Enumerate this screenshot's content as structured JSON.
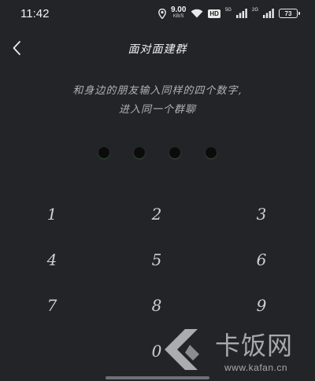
{
  "status_bar": {
    "time": "11:42",
    "net_speed_value": "9.00",
    "net_speed_unit": "KB/S",
    "hd_badge": "HD",
    "net_tag_1": "5G",
    "net_tag_2": "2G",
    "battery": "73"
  },
  "header": {
    "title": "面对面建群"
  },
  "instruction": {
    "line1": "和身边的朋友输入同样的四个数字,",
    "line2": "进入同一个群聊"
  },
  "pin": {
    "entered": 0,
    "length": 4
  },
  "keypad": {
    "keys": [
      "1",
      "2",
      "3",
      "4",
      "5",
      "6",
      "7",
      "8",
      "9",
      "0"
    ]
  },
  "watermark": {
    "title": "卡饭网",
    "url": "www.kafan.cn"
  },
  "colors": {
    "background": "#232428",
    "text_primary": "#f0f0f0",
    "text_secondary": "#b2b2b4",
    "pin_dot": "#0b0b0c"
  },
  "icons": {
    "back": "chevron-left-icon",
    "location": "location-icon",
    "wifi": "wifi-icon",
    "signal": "signal-icon",
    "battery": "battery-icon"
  }
}
